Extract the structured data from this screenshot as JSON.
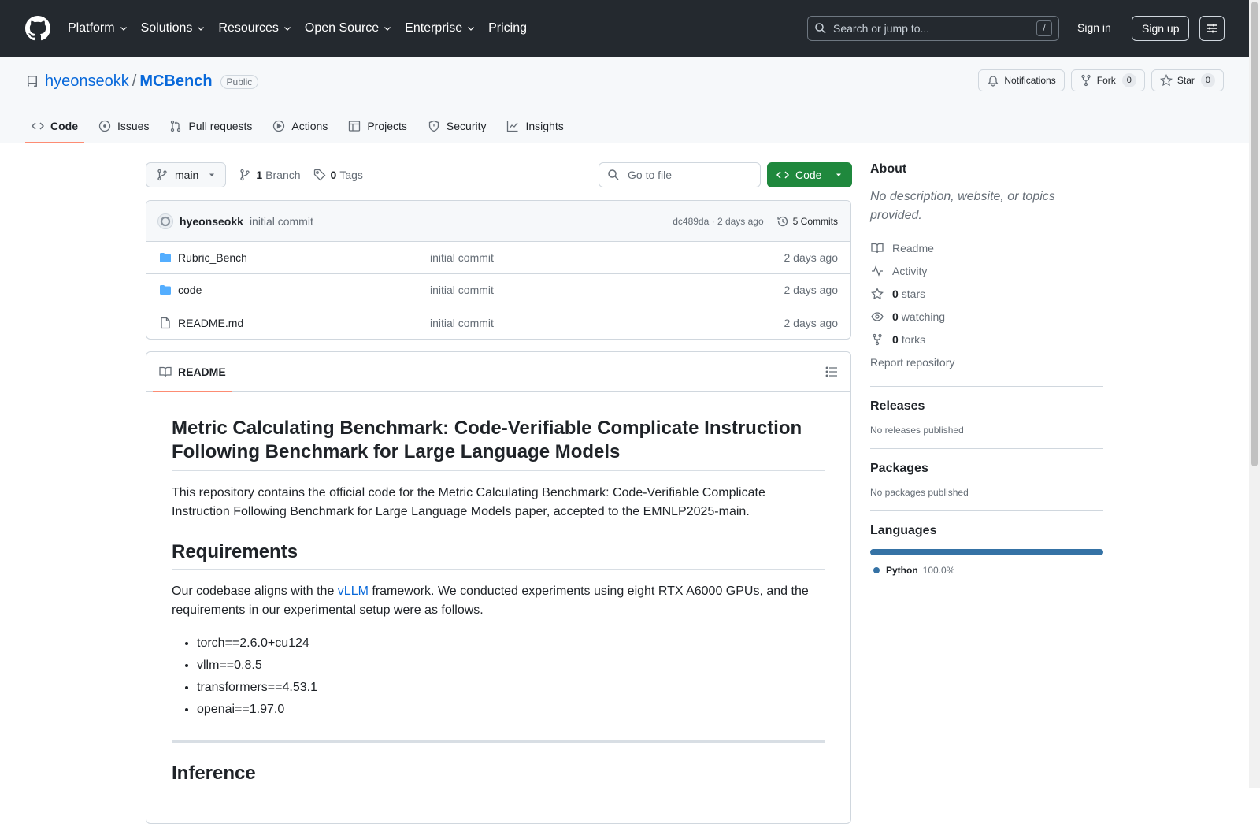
{
  "header": {
    "nav": [
      "Platform",
      "Solutions",
      "Resources",
      "Open Source",
      "Enterprise",
      "Pricing"
    ],
    "search_placeholder": "Search or jump to...",
    "search_key": "/",
    "sign_in": "Sign in",
    "sign_up": "Sign up"
  },
  "repo": {
    "owner": "hyeonseokk",
    "separator": "/",
    "name": "MCBench",
    "visibility": "Public",
    "notifications": "Notifications",
    "fork_label": "Fork",
    "fork_count": "0",
    "star_label": "Star",
    "star_count": "0",
    "tabs": [
      "Code",
      "Issues",
      "Pull requests",
      "Actions",
      "Projects",
      "Security",
      "Insights"
    ]
  },
  "toolbar": {
    "branch": "main",
    "branch_count": "1",
    "branch_label": "Branch",
    "tag_count": "0",
    "tag_label": "Tags",
    "goto_placeholder": "Go to file",
    "code_button": "Code"
  },
  "commit": {
    "author": "hyeonseokk",
    "message": "initial commit",
    "hash_time": "dc489da · 2 days ago",
    "commits": "5 Commits"
  },
  "files": [
    {
      "name": "Rubric_Bench",
      "type": "folder",
      "message": "initial commit",
      "date": "2 days ago"
    },
    {
      "name": "code",
      "type": "folder",
      "message": "initial commit",
      "date": "2 days ago"
    },
    {
      "name": "README.md",
      "type": "file",
      "message": "initial commit",
      "date": "2 days ago"
    }
  ],
  "readme": {
    "tab": "README",
    "title": "Metric Calculating Benchmark: Code-Verifiable Complicate Instruction Following Benchmark for Large Language Models",
    "intro": "This repository contains the official code for the Metric Calculating Benchmark: Code-Verifiable Complicate Instruction Following Benchmark for Large Language Models paper, accepted to the EMNLP2025-main.",
    "req_heading": "Requirements",
    "req_before": "Our codebase aligns with the ",
    "req_link": "vLLM ",
    "req_after": "framework. We conducted experiments using eight RTX A6000 GPUs, and the requirements in our experimental setup were as follows.",
    "requirements": [
      "torch==2.6.0+cu124",
      "vllm==0.8.5",
      "transformers==4.53.1",
      "openai==1.97.0"
    ],
    "inference_heading": "Inference"
  },
  "sidebar": {
    "about_heading": "About",
    "about_desc": "No description, website, or topics provided.",
    "readme_link": "Readme",
    "activity_link": "Activity",
    "stars_count": "0",
    "stars_label": "stars",
    "watching_count": "0",
    "watching_label": "watching",
    "forks_count": "0",
    "forks_label": "forks",
    "report": "Report repository",
    "releases_heading": "Releases",
    "releases_text": "No releases published",
    "packages_heading": "Packages",
    "packages_text": "No packages published",
    "languages_heading": "Languages",
    "language_name": "Python",
    "language_pct": "100.0%",
    "language_color": "#3572A5"
  }
}
